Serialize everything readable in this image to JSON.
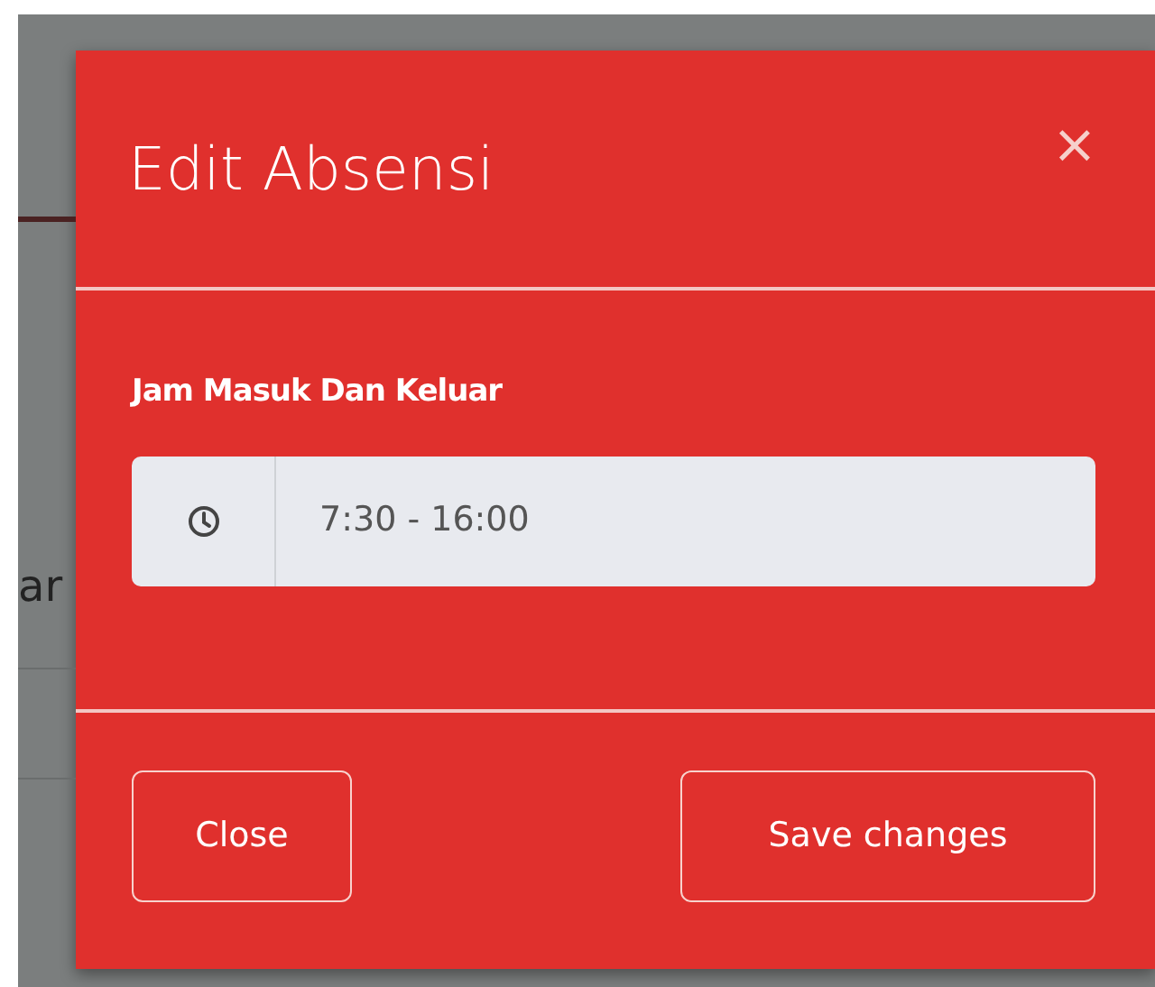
{
  "background_page": {
    "text": "ar"
  },
  "modal": {
    "title": "Edit Absensi",
    "close_symbol": "×",
    "field": {
      "label": "Jam Masuk Dan Keluar",
      "value": "7:30 - 16:00",
      "readonly": true
    },
    "buttons": [
      {
        "label": "Close",
        "kind": "secondary"
      },
      {
        "label": "Save changes",
        "kind": "primary"
      }
    ]
  }
}
